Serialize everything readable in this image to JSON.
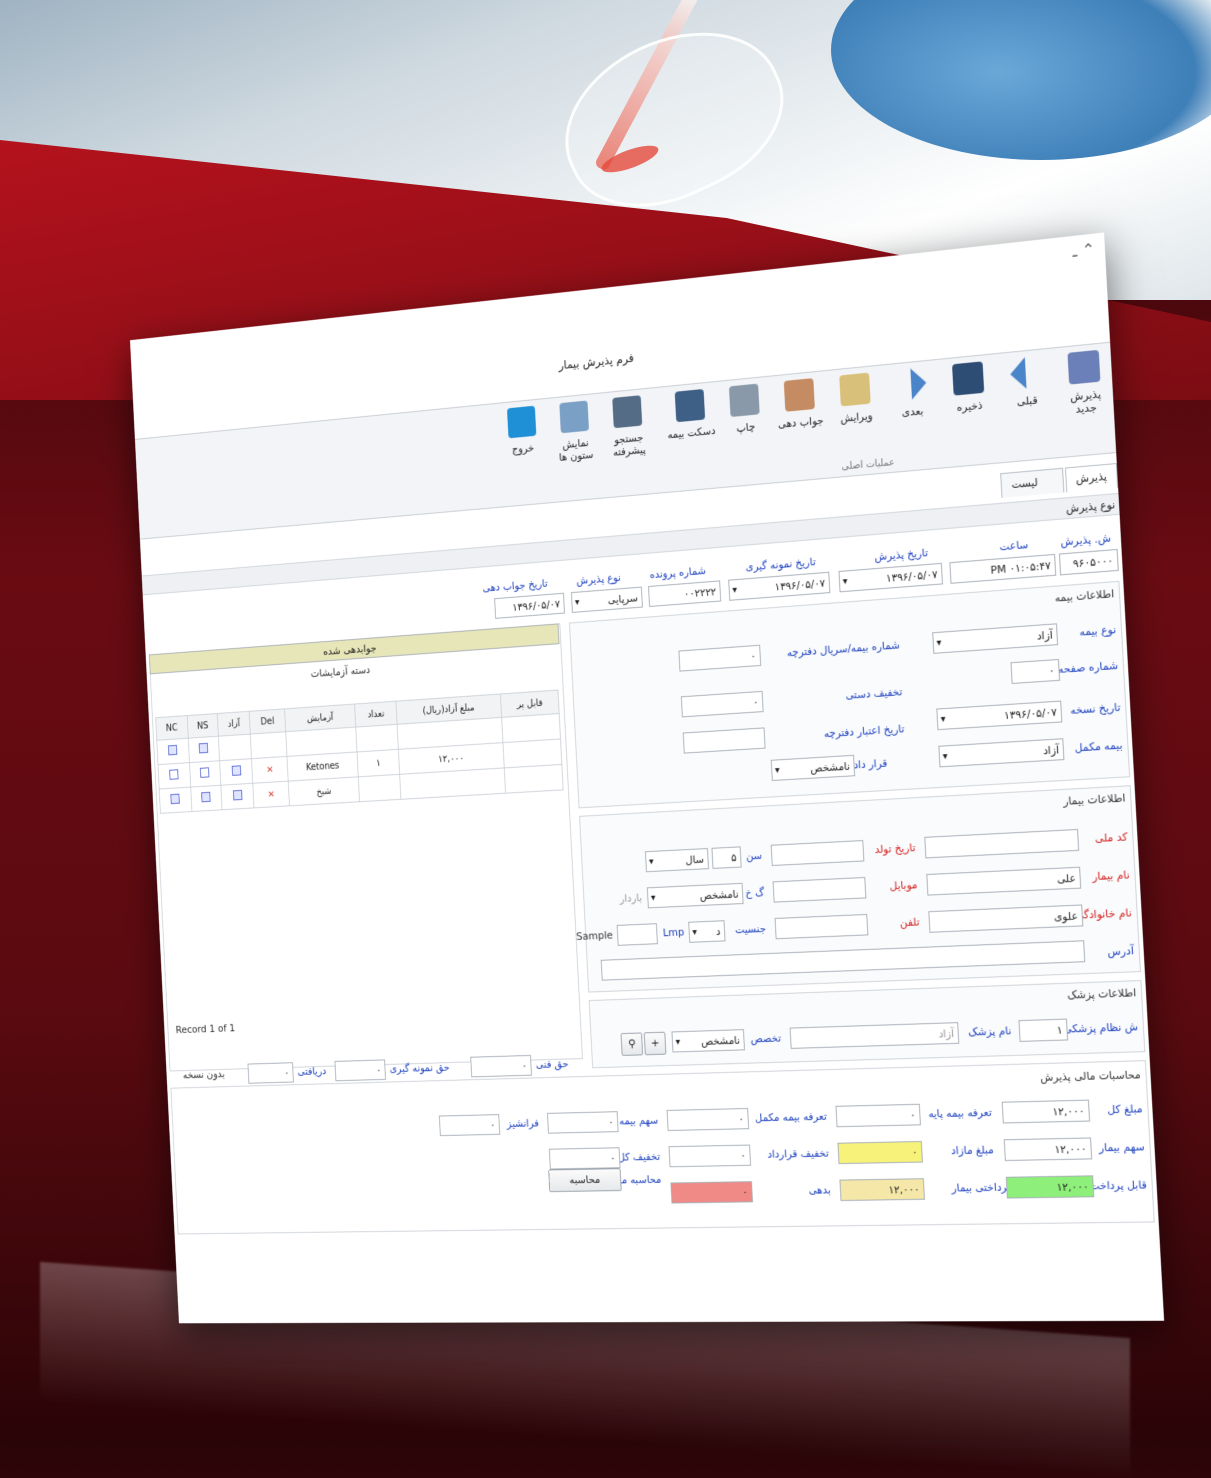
{
  "window": {
    "title": "فرم پذیرش بیمار"
  },
  "ribbon": {
    "buttons": [
      {
        "label": "پذیرش جدید"
      },
      {
        "label": "قبلی"
      },
      {
        "label": "ذخیره"
      },
      {
        "label": "بعدی"
      },
      {
        "label": "ویرایش"
      },
      {
        "label": "جواب دهی"
      },
      {
        "label": "چاپ"
      },
      {
        "label": "دسکت بیمه"
      },
      {
        "label": "جستجو پیشرفته"
      },
      {
        "label": "نمایش ستون ها"
      },
      {
        "label": "خروج"
      }
    ],
    "group_label": "عملیات اصلی"
  },
  "tabs": [
    "پذیرش",
    "لیست پذیرش"
  ],
  "top_section": "نوع پذیرش",
  "fields": {
    "reception_no_label": "ش. پذیرش",
    "reception_no": "۹۶۰۵۰۰۰",
    "time_label": "ساعت",
    "time": "PM ۰۱:۰۵:۴۷",
    "reception_date_label": "تاریخ پذیرش",
    "reception_date": "۱۳۹۶/۰۵/۰۷",
    "sample_date_label": "تاریخ نمونه گیری",
    "sample_date": "۱۳۹۶/۰۵/۰۷",
    "file_no_label": "شماره پرونده",
    "file_no": "۰۰۲۲۲۲",
    "reception_type_label": "نوع پذیرش",
    "reception_type": "سرپایی",
    "answer_date_label": "تاریخ جواب دهی",
    "answer_date": "۱۳۹۶/۰۵/۰۷"
  },
  "insurance": {
    "section": "اطلاعات بیمه",
    "type_label": "نوع بیمه",
    "type": "آزاد",
    "book_no_label": "شماره بیمه/سریال دفترچه",
    "book_no": "۰",
    "page_no_label": "شماره صفحه",
    "page_no": "۰",
    "manual_discount_label": "تخفیف دستی",
    "manual_discount": "۰",
    "copy_date_label": "تاریخ نسخه",
    "copy_date": "۱۳۹۶/۰۵/۰۷",
    "book_valid_label": "تاریخ اعتبار دفترچه",
    "book_valid": "",
    "supp_label": "بیمه مکمل",
    "supp": "آزاد",
    "contract_label": "قرار داد",
    "contract": "نامشخص"
  },
  "patient": {
    "section": "اطلاعات بیمار",
    "national_label": "کد ملی",
    "national": "",
    "birth_label": "تاریخ تولد",
    "birth": "",
    "age_label": "سن",
    "age": "۵",
    "age_unit": "سال",
    "name_label": "نام بیمار",
    "name": "علی",
    "mobile_label": "موبایل",
    "mobile": "",
    "blood_label": "گ خ",
    "blood": "نامشخص",
    "pregnant_label": "باردار",
    "family_label": "نام خانوادگی",
    "family": "علوی",
    "phone_label": "تلفن",
    "phone": "",
    "gender_label": "جنسیت",
    "gender": "د",
    "lmp_label": "Lmp",
    "nosample_label": "NoSample",
    "address_label": "آدرس",
    "address": ""
  },
  "doctor": {
    "section": "اطلاعات پزشک",
    "code_label": "ش نظام پزشکی",
    "code": "۱",
    "name_label": "نام پزشک",
    "name": "آزاد",
    "spec_label": "تخصص",
    "spec": "نامشخص"
  },
  "finance": {
    "section": "محاسبات مالی پذیرش",
    "total_label": "مبلغ کل",
    "total": "۱۲,۰۰۰",
    "base_label": "تعرفه بیمه پایه",
    "base": "۰",
    "supp_tariff_label": "تعرفه بیمه مکمل",
    "supp_tariff": "۰",
    "insurance_share_label": "سهم بیمه",
    "insurance_share": "۰",
    "franchise_label": "فرانشیز",
    "franchise": "۰",
    "patient_share_label": "سهم بیمار",
    "patient_share": "۱۲,۰۰۰",
    "excess_label": "مبلغ مازاد",
    "excess": "۰",
    "contract_discount_label": "تخفیف قرارداد",
    "contract_discount": "۰",
    "total_discount_label": "تخفیف کل",
    "total_discount": "۰",
    "payable_label": "قابل پرداخت",
    "payable": "۱۲,۰۰۰",
    "patient_paid_label": "پرداختی بیمار",
    "patient_paid": "۱۲,۰۰۰",
    "debt_label": "بدهی",
    "debt": "۰",
    "recalc_label": "محاسبه مجدد",
    "calc_button": "محاسبه"
  },
  "tests": {
    "status_bar": "جوابدهی شده",
    "group_label": "دسته آزمایشات",
    "columns": [
      "NC",
      "NS",
      "آزاد",
      "Del",
      "آزمایش",
      "تعداد",
      "مبلغ آزاد(ریال)",
      "قابل پر"
    ],
    "rows": [
      {
        "name": "",
        "count": "",
        "price": ""
      },
      {
        "name": "Ketones",
        "count": "۱",
        "price": "۱۲,۰۰۰"
      },
      {
        "name": "شیخ",
        "count": "",
        "price": ""
      }
    ],
    "record": "Record 1 of 1",
    "tech_fee_label": "حق فنی",
    "tech_fee": "۰",
    "sample_fee_label": "حق نمونه گیری",
    "sample_fee": "۰",
    "received_label": "دریافتی",
    "received": "۰",
    "no_copy_label": "بدون نسخه"
  },
  "colors": {
    "debt": "#f08a86",
    "excess": "#f7f27a",
    "paid": "#8ef07a",
    "patient_share": "#f4e7a8"
  }
}
